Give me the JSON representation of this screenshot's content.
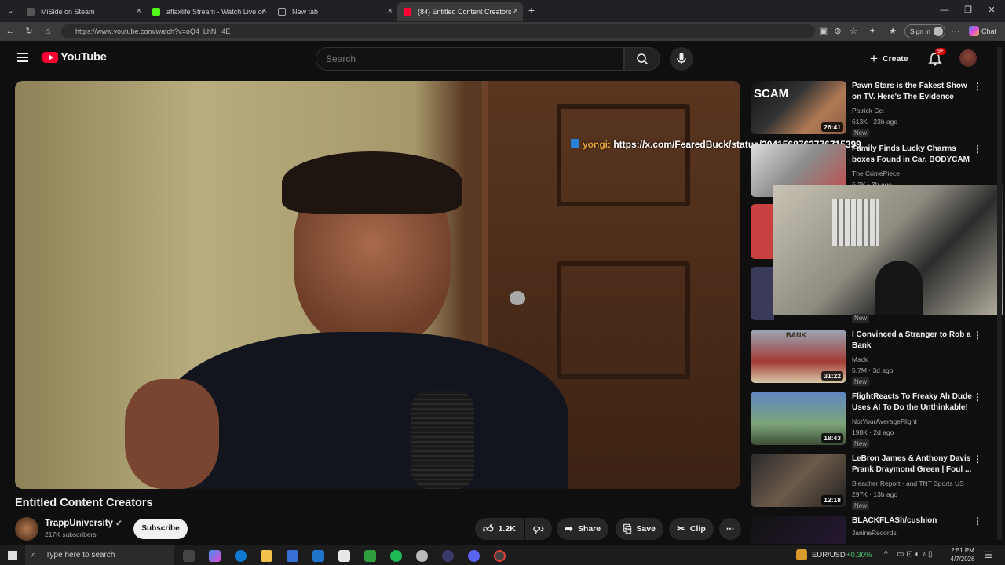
{
  "browser": {
    "tabs": [
      {
        "title": "MiSide on Steam",
        "active": false
      },
      {
        "title": "aflaxlife Stream - Watch Live on K",
        "active": false
      },
      {
        "title": "New tab",
        "active": false
      },
      {
        "title": "(84) Entitled Content Creators - Yo",
        "active": true
      }
    ],
    "url": "https://www.youtube.com/watch?v=oQ4_LhN_i4E",
    "sign_in": "Sign in",
    "chat": "Chat"
  },
  "youtube": {
    "logo": "YouTube",
    "search_placeholder": "Search",
    "create": "Create",
    "notif_badge": "9+",
    "video_title": "Entitled Content Creators",
    "channel": "TrappUniversity",
    "subscribers": "217K subscribers",
    "subscribe": "Subscribe",
    "likes": "1.2K",
    "share": "Share",
    "save": "Save",
    "clip": "Clip",
    "overlay_user": "yongi:",
    "overlay_link": "https://x.com/FearedBuck/status/2041568762776715399"
  },
  "recommendations": [
    {
      "title": "Pawn Stars is the Fakest Show on TV. Here's The Evidence",
      "channel": "Patrick Cc:",
      "meta": "613K · 23h ago",
      "badge": "New",
      "duration": "26:41"
    },
    {
      "title": "Family Finds Lucky Charms boxes Found in Car. BODYCAM",
      "channel": "The CrimePiece",
      "meta": "6.2K · 2h ago",
      "badge": "",
      "duration": ""
    },
    {
      "title": "I Convinced a Stranger to Rob a Bank",
      "channel": "Mack",
      "meta": "5.7M · 3d ago",
      "badge": "New",
      "duration": "31:22"
    },
    {
      "title": "FlightReacts To Freaky Ah Dude Uses AI To Do the Unthinkable!",
      "channel": "NotYourAverageFlight",
      "meta": "198K · 2d ago",
      "badge": "New",
      "duration": "18:43"
    },
    {
      "title": "LeBron James & Anthony Davis Prank Draymond Green | Foul ...",
      "channel": "Bleacher Report · and TNT Sports US",
      "meta": "297K · 13h ago",
      "badge": "New",
      "duration": "12:18"
    },
    {
      "title": "BLACKFLASh/cushion",
      "channel": "JanineRecords",
      "meta": "",
      "badge": "",
      "duration": ""
    }
  ],
  "extra_badge": "New",
  "taskbar": {
    "search_placeholder": "Type here to search",
    "ticker": "EUR/USD",
    "ticker_change": "+0.30%",
    "time": "2:51 PM",
    "date": "4/7/2026"
  }
}
